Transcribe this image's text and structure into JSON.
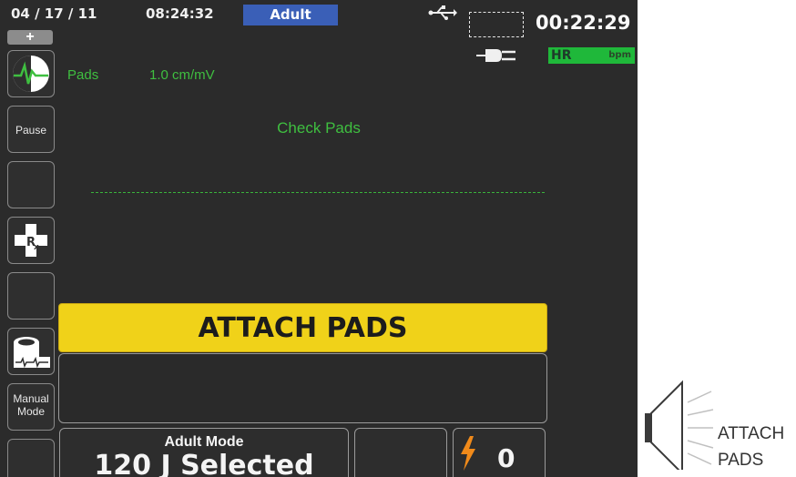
{
  "header": {
    "date": "04 / 17 / 11",
    "time": "08:24:32",
    "patient_mode": "Adult",
    "elapsed_time": "00:22:29",
    "hr_label": "HR",
    "hr_unit": "bpm"
  },
  "sidebar": {
    "add_symbol": "+",
    "buttons": [
      {
        "icon": "ecg-heart-icon",
        "label": ""
      },
      {
        "icon": "",
        "label": "Pause"
      },
      {
        "icon": "",
        "label": ""
      },
      {
        "icon": "rx-cross-icon",
        "label": ""
      },
      {
        "icon": "",
        "label": ""
      },
      {
        "icon": "printer-strip-icon",
        "label": ""
      },
      {
        "icon": "",
        "label_line1": "Manual",
        "label_line2": "Mode"
      }
    ]
  },
  "waveform": {
    "lead": "Pads",
    "scale": "1.0 cm/mV",
    "status": "Check Pads",
    "color": "#3fbf40"
  },
  "alarm": {
    "text": "ATTACH PADS",
    "color": "#f0d219"
  },
  "energy": {
    "mode": "Adult Mode",
    "selected": "120 J Selected"
  },
  "shock": {
    "icon": "lightning-bolt-icon",
    "count": "0"
  },
  "voice_prompt": {
    "icon": "speaker-icon",
    "line1": "ATTACH",
    "line2": "PADS"
  }
}
